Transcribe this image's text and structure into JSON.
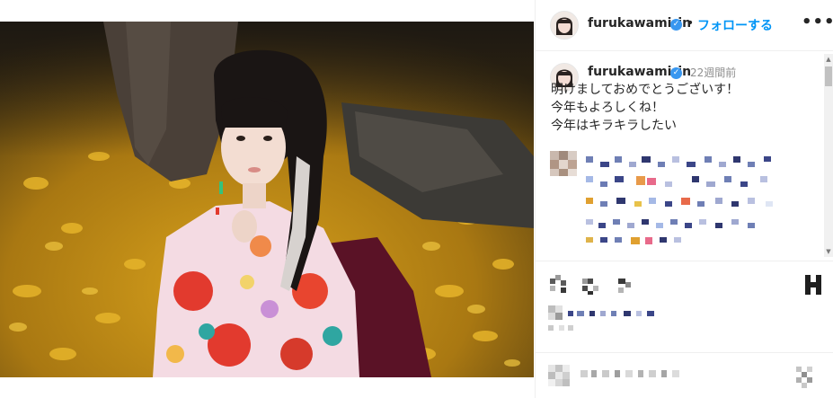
{
  "post": {
    "image_alt": "Photo of a person in a colorful floral kimono sitting on yellow ginkgo leaves"
  },
  "header": {
    "username": "furukawamirin",
    "verified_mark": "✓",
    "separator": "•",
    "follow_label": "フォローする",
    "more_icon": "more-horizontal-icon"
  },
  "caption": {
    "username": "furukawamirin",
    "verified_mark": "✓",
    "time": "22週間前",
    "lines": [
      "明けましておめでとうございす！",
      "今年もよろしくね！",
      "今年はキラキラしたい"
    ]
  },
  "actions": {
    "save_icon": "bookmark-icon"
  },
  "colors": {
    "accent": "#0095f6",
    "verified": "#3897f0",
    "muted": "#8e8e8e"
  }
}
